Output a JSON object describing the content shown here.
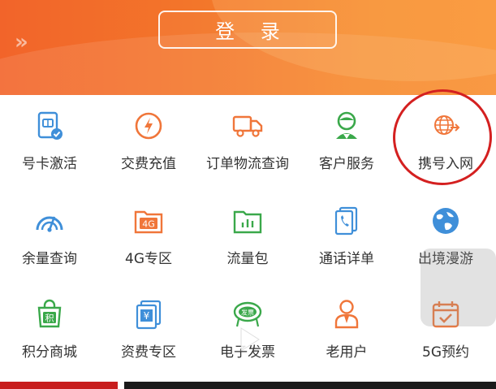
{
  "header": {
    "login_label": "登 录",
    "colors": {
      "start": "#f2642a",
      "end": "#f98e2e"
    }
  },
  "services": [
    {
      "label": "号卡激活",
      "icon": "sim-card-icon",
      "color": "#3f8fd9"
    },
    {
      "label": "交费充值",
      "icon": "recharge-lightning-icon",
      "color": "#f0763a"
    },
    {
      "label": "订单物流查询",
      "icon": "delivery-truck-icon",
      "color": "#f0763a"
    },
    {
      "label": "客户服务",
      "icon": "customer-service-icon",
      "color": "#3aa84a"
    },
    {
      "label": "携号入网",
      "icon": "number-porting-globe-icon",
      "color": "#f0763a"
    },
    {
      "label": "余量查询",
      "icon": "gauge-icon",
      "color": "#3f8fd9"
    },
    {
      "label": "4G专区",
      "icon": "4g-folder-icon",
      "color": "#f0763a"
    },
    {
      "label": "流量包",
      "icon": "data-package-icon",
      "color": "#3aa84a"
    },
    {
      "label": "通话详单",
      "icon": "call-detail-icon",
      "color": "#3f8fd9"
    },
    {
      "label": "出境漫游",
      "icon": "globe-roaming-icon",
      "color": "#3f8fd9"
    },
    {
      "label": "积分商城",
      "icon": "points-bag-icon",
      "color": "#3aa84a"
    },
    {
      "label": "资费专区",
      "icon": "tariff-yuan-icon",
      "color": "#3f8fd9"
    },
    {
      "label": "电子发票",
      "icon": "invoice-icon",
      "color": "#3aa84a"
    },
    {
      "label": "老用户",
      "icon": "old-user-icon",
      "color": "#f0763a"
    },
    {
      "label": "5G预约",
      "icon": "5g-calendar-icon",
      "color": "#f0763a"
    }
  ],
  "invoice_badge_text": "发票",
  "points_badge_text": "积",
  "tariff_badge_text": "¥",
  "fourg_badge_text": "4G"
}
